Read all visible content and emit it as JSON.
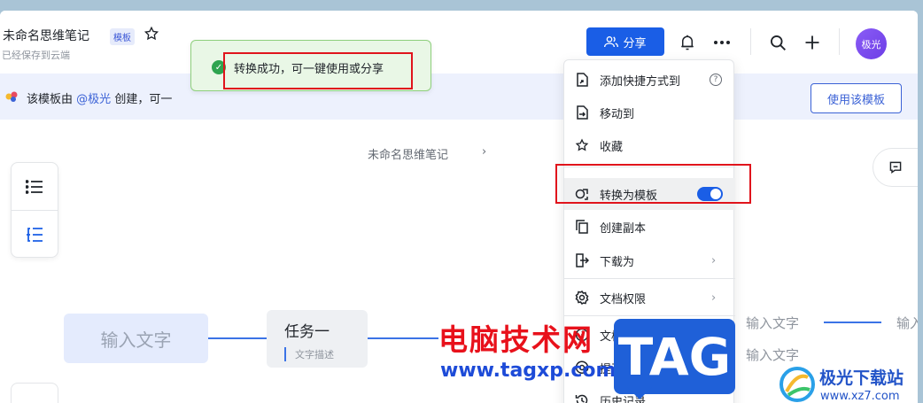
{
  "header": {
    "doc_title": "未命名思维笔记",
    "template_badge": "模板",
    "save_status": "已经保存到云端",
    "share_label": "分享",
    "avatar_label": "极光"
  },
  "banner": {
    "prefix": "该模板由",
    "mention": "@极光",
    "suffix": "创建，可一",
    "use_template_label": "使用该模板"
  },
  "toast": {
    "message": "转换成功，可一键使用或分享"
  },
  "canvas": {
    "breadcrumb_title": "未命名思维笔记",
    "root_node": "输入文字",
    "task_node_title": "任务一",
    "task_node_desc": "文字描述",
    "child_node_1": "输入文字",
    "child_node_2": "输入文字",
    "child_node_3": "输入"
  },
  "menu": {
    "items": [
      {
        "label": "添加快捷方式到",
        "icon": "shortcut-add-icon"
      },
      {
        "label": "移动到",
        "icon": "move-icon"
      },
      {
        "label": "收藏",
        "icon": "star-icon"
      },
      {
        "label": "转换为模板",
        "icon": "template-convert-icon",
        "toggle_on": true
      },
      {
        "label": "创建副本",
        "icon": "copy-icon"
      },
      {
        "label": "下载为",
        "icon": "download-icon"
      },
      {
        "label": "文档权限",
        "icon": "gear-icon"
      },
      {
        "label": "文档信息",
        "icon": "info-icon"
      },
      {
        "label": "提及的人",
        "icon": "at-icon"
      },
      {
        "label": "历史记录",
        "icon": "history-icon"
      }
    ]
  },
  "watermarks": {
    "cn_text": "电脑技术网",
    "url": "www.tagxp.com",
    "tag": "TAG",
    "site_name": "极光下载站",
    "site_url": "www.xz7.com"
  },
  "colors": {
    "accent": "#1a5ee6",
    "banner_bg": "#edf1fd",
    "toast_bg": "#e9f7e6",
    "highlight": "#e0141c"
  }
}
